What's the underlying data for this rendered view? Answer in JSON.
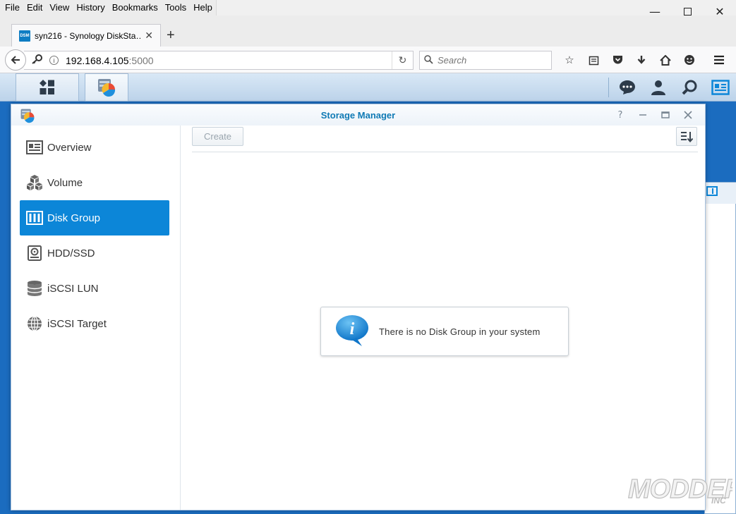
{
  "browser": {
    "menu": [
      "File",
      "Edit",
      "View",
      "History",
      "Bookmarks",
      "Tools",
      "Help"
    ],
    "tab": {
      "favicon_text": "DSM",
      "title": "syn216 - Synology DiskSta…"
    },
    "url": {
      "host": "192.168.4.105",
      "port": ":5000"
    },
    "search_placeholder": "Search"
  },
  "window": {
    "title": "Storage Manager",
    "help_glyph": "?"
  },
  "sidebar": {
    "items": [
      {
        "label": "Overview",
        "icon": "overview-icon"
      },
      {
        "label": "Volume",
        "icon": "volume-icon"
      },
      {
        "label": "Disk Group",
        "icon": "disk-group-icon",
        "active": true
      },
      {
        "label": "HDD/SSD",
        "icon": "hdd-icon"
      },
      {
        "label": "iSCSI LUN",
        "icon": "iscsi-lun-icon"
      },
      {
        "label": "iSCSI Target",
        "icon": "iscsi-target-icon"
      }
    ]
  },
  "toolbar": {
    "create_label": "Create"
  },
  "empty_state": {
    "message": "There is no Disk Group in your system"
  },
  "watermark": "MODDERS INC",
  "colors": {
    "accent": "#0c86d8",
    "desktop": "#1b6cbf",
    "title": "#0f7ab5"
  }
}
